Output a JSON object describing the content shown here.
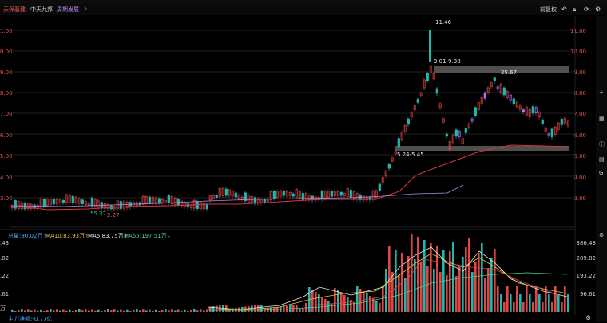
{
  "tabs": [
    {
      "label": "天保基建",
      "state": "active"
    },
    {
      "label": "中天九邦",
      "state": "normal"
    },
    {
      "label": "周期发展",
      "state": "sub"
    }
  ],
  "toolbar": {
    "rights_label": "前复权",
    "icons": [
      "undo-icon",
      "lock-icon",
      "refresh-icon",
      "settings-icon"
    ]
  },
  "price_axis": {
    "ticks": [
      "11.00",
      "10.00",
      "9.00",
      "8.00",
      "7.00",
      "6.00",
      "5.00",
      "4.00",
      "3.00"
    ],
    "left_ticks": [
      "1.00",
      "0.00",
      "9.00",
      "8.00",
      "7.00",
      "6.00",
      "5.00",
      "4.00",
      "3.00"
    ]
  },
  "annotations": {
    "high": "11.46",
    "zone_upper": "9.01-9.38",
    "zone_upper_peak": "25.67",
    "zone_lower": "5.24-5.45",
    "low_a": "2.27",
    "low_b": "55.37"
  },
  "volume": {
    "legend": [
      {
        "label": "总量:90.02万↑",
        "color": "#46a8ff"
      },
      {
        "label": "MA10:83.93万↑",
        "color": "#f0c040"
      },
      {
        "label": "MA5:83.75万↑",
        "color": "#e8e8e8"
      },
      {
        "label": "MA55:197.51万↓",
        "color": "#4cd28a"
      }
    ],
    "right_ticks": [
      "386.43",
      "289.82",
      "193.22",
      "96.61"
    ],
    "left_ticks": [
      ".43",
      ".82",
      ".22",
      ".61",
      "万"
    ]
  },
  "bottom": {
    "label": "主力净额:-0.77亿"
  },
  "colors": {
    "up": "#e04646",
    "down": "#1fb7b0",
    "purple": "#a978ff"
  }
}
